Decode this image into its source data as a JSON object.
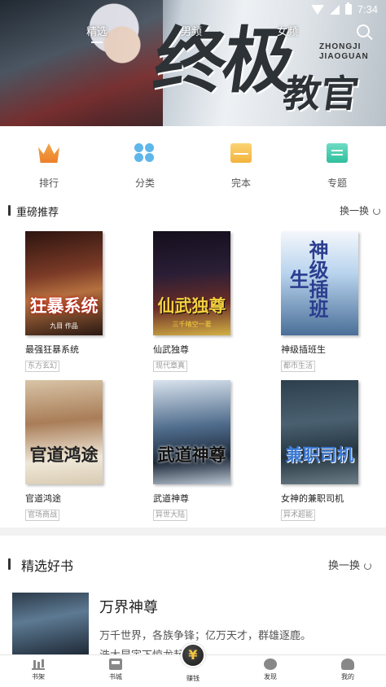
{
  "status_bar": {
    "time": "7:34"
  },
  "banner": {
    "title_main": "终极",
    "title_sub": "教官",
    "pinyin_1": "ZHONGJI",
    "pinyin_2": "JIAOGUAN"
  },
  "top_tabs": [
    {
      "label": "精选",
      "active": true
    },
    {
      "label": "男频",
      "active": false
    },
    {
      "label": "女频",
      "active": false
    }
  ],
  "categories": [
    {
      "label": "排行",
      "icon": "crown-icon",
      "color": "#f08a30"
    },
    {
      "label": "分类",
      "icon": "grid-icon",
      "color": "#5fb6ea"
    },
    {
      "label": "完本",
      "icon": "book-icon",
      "color": "#f5bf45"
    },
    {
      "label": "专题",
      "icon": "topic-icon",
      "color": "#3cc7a6"
    }
  ],
  "recommend": {
    "title": "重磅推荐",
    "more_label": "换一换",
    "books": [
      {
        "name": "最强狂暴系统",
        "tag": "东方玄幻",
        "cover_text": "狂暴系统",
        "cover_author": "九目 作品"
      },
      {
        "name": "仙武独尊",
        "tag": "现代章真",
        "cover_text": "仙武独尊",
        "cover_author": "三千晴空一著"
      },
      {
        "name": "神级插班生",
        "tag": "都市生活",
        "cover_text": "神级插班生",
        "cover_author": ""
      },
      {
        "name": "官道鸿途",
        "tag": "官场商战",
        "cover_text": "官道鸿途",
        "cover_author": ""
      },
      {
        "name": "武道神尊",
        "tag": "异世大陆",
        "cover_text": "武道神尊",
        "cover_author": ""
      },
      {
        "name": "女神的兼职司机",
        "tag": "异术超能",
        "cover_text": "兼职司机",
        "cover_author": ""
      }
    ]
  },
  "featured": {
    "title": "精选好书",
    "more_label": "换一换",
    "book_title": "万界神尊",
    "desc_line1": "万千世界，各族争锋；亿万天才，群雄逐鹿。",
    "desc_line2": "浩大昆宇下惊龙起，..."
  },
  "bottom_nav": [
    {
      "label": "书架",
      "icon": "shelf-icon"
    },
    {
      "label": "书城",
      "icon": "store-icon"
    },
    {
      "label": "赚钱",
      "icon": "yuan-coin-icon",
      "glyph": "¥"
    },
    {
      "label": "发现",
      "icon": "discover-icon"
    },
    {
      "label": "我的",
      "icon": "profile-icon"
    }
  ],
  "colors": {
    "accent": "#f08a30",
    "text": "#222222",
    "muted": "#999999"
  }
}
